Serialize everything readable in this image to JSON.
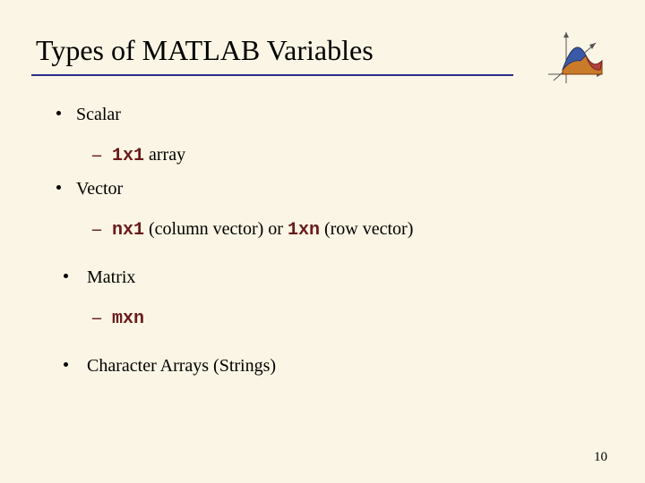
{
  "title": "Types of MATLAB Variables",
  "bullets": {
    "scalar": {
      "label": "Scalar",
      "sub": {
        "code": "1x1",
        "after": " array"
      }
    },
    "vector": {
      "label": "Vector",
      "sub": {
        "code1": "nx1",
        "mid": "  (column vector) or ",
        "code2": "1xn",
        "after": " (row vector)"
      }
    },
    "matrix": {
      "label": " Matrix",
      "sub": {
        "code": "mxn"
      }
    },
    "strings": {
      "label": " Character Arrays (Strings)"
    }
  },
  "page_number": "10",
  "logo_alt": "matlab-logo"
}
